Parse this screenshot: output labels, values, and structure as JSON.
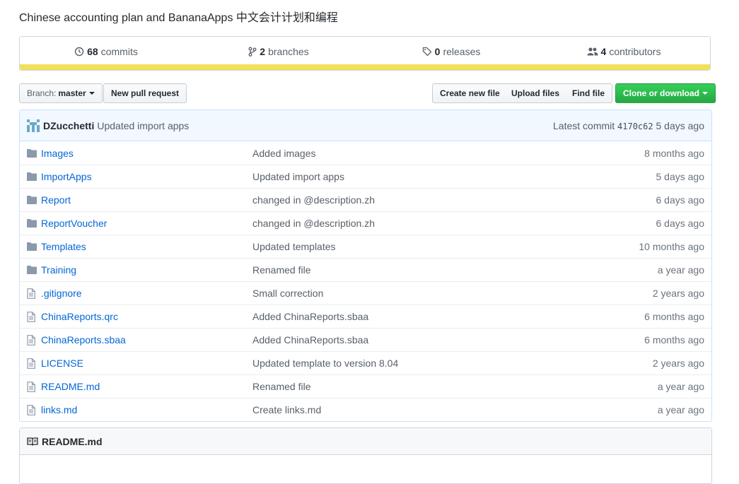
{
  "repo": {
    "description": "Chinese accounting plan and BananaApps 中文会计计划和编程"
  },
  "summary": {
    "commits_count": "68",
    "commits_label": "commits",
    "branches_count": "2",
    "branches_label": "branches",
    "releases_count": "0",
    "releases_label": "releases",
    "contributors_count": "4",
    "contributors_label": "contributors",
    "language_color": "#f1e05a"
  },
  "toolbar": {
    "branch_prefix": "Branch:",
    "branch_name": "master",
    "new_pull_request": "New pull request",
    "create_new_file": "Create new file",
    "upload_files": "Upload files",
    "find_file": "Find file",
    "clone_or_download": "Clone or download"
  },
  "latest_commit": {
    "author": "DZucchetti",
    "message": "Updated import apps",
    "label": "Latest commit",
    "sha": "4170c62",
    "age": "5 days ago"
  },
  "files": [
    {
      "type": "folder",
      "name": "Images",
      "message": "Added images",
      "age": "8 months ago"
    },
    {
      "type": "folder",
      "name": "ImportApps",
      "message": "Updated import apps",
      "age": "5 days ago"
    },
    {
      "type": "folder",
      "name": "Report",
      "message": "changed in @description.zh",
      "age": "6 days ago"
    },
    {
      "type": "folder",
      "name": "ReportVoucher",
      "message": "changed in @description.zh",
      "age": "6 days ago"
    },
    {
      "type": "folder",
      "name": "Templates",
      "message": "Updated templates",
      "age": "10 months ago"
    },
    {
      "type": "folder",
      "name": "Training",
      "message": "Renamed file",
      "age": "a year ago"
    },
    {
      "type": "file",
      "name": ".gitignore",
      "message": "Small correction",
      "age": "2 years ago"
    },
    {
      "type": "file",
      "name": "ChinaReports.qrc",
      "message": "Added ChinaReports.sbaa",
      "age": "6 months ago"
    },
    {
      "type": "file",
      "name": "ChinaReports.sbaa",
      "message": "Added ChinaReports.sbaa",
      "age": "6 months ago"
    },
    {
      "type": "file",
      "name": "LICENSE",
      "message": "Updated template to version 8.04",
      "age": "2 years ago"
    },
    {
      "type": "file",
      "name": "README.md",
      "message": "Renamed file",
      "age": "a year ago"
    },
    {
      "type": "file",
      "name": "links.md",
      "message": "Create links.md",
      "age": "a year ago"
    }
  ],
  "readme": {
    "title": "README.md"
  }
}
